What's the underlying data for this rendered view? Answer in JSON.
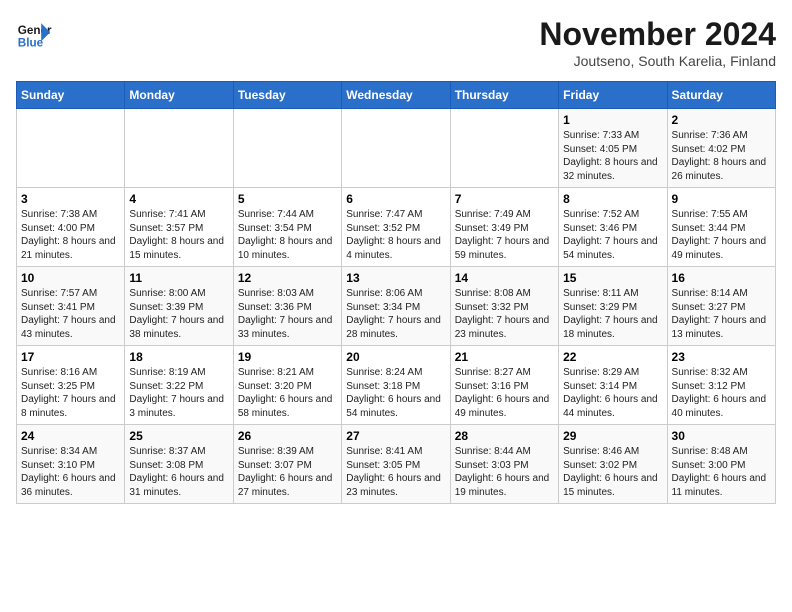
{
  "logo": {
    "line1": "General",
    "line2": "Blue"
  },
  "title": "November 2024",
  "subtitle": "Joutseno, South Karelia, Finland",
  "days_of_week": [
    "Sunday",
    "Monday",
    "Tuesday",
    "Wednesday",
    "Thursday",
    "Friday",
    "Saturday"
  ],
  "weeks": [
    [
      {
        "day": "",
        "detail": ""
      },
      {
        "day": "",
        "detail": ""
      },
      {
        "day": "",
        "detail": ""
      },
      {
        "day": "",
        "detail": ""
      },
      {
        "day": "",
        "detail": ""
      },
      {
        "day": "1",
        "detail": "Sunrise: 7:33 AM\nSunset: 4:05 PM\nDaylight: 8 hours and 32 minutes."
      },
      {
        "day": "2",
        "detail": "Sunrise: 7:36 AM\nSunset: 4:02 PM\nDaylight: 8 hours and 26 minutes."
      }
    ],
    [
      {
        "day": "3",
        "detail": "Sunrise: 7:38 AM\nSunset: 4:00 PM\nDaylight: 8 hours and 21 minutes."
      },
      {
        "day": "4",
        "detail": "Sunrise: 7:41 AM\nSunset: 3:57 PM\nDaylight: 8 hours and 15 minutes."
      },
      {
        "day": "5",
        "detail": "Sunrise: 7:44 AM\nSunset: 3:54 PM\nDaylight: 8 hours and 10 minutes."
      },
      {
        "day": "6",
        "detail": "Sunrise: 7:47 AM\nSunset: 3:52 PM\nDaylight: 8 hours and 4 minutes."
      },
      {
        "day": "7",
        "detail": "Sunrise: 7:49 AM\nSunset: 3:49 PM\nDaylight: 7 hours and 59 minutes."
      },
      {
        "day": "8",
        "detail": "Sunrise: 7:52 AM\nSunset: 3:46 PM\nDaylight: 7 hours and 54 minutes."
      },
      {
        "day": "9",
        "detail": "Sunrise: 7:55 AM\nSunset: 3:44 PM\nDaylight: 7 hours and 49 minutes."
      }
    ],
    [
      {
        "day": "10",
        "detail": "Sunrise: 7:57 AM\nSunset: 3:41 PM\nDaylight: 7 hours and 43 minutes."
      },
      {
        "day": "11",
        "detail": "Sunrise: 8:00 AM\nSunset: 3:39 PM\nDaylight: 7 hours and 38 minutes."
      },
      {
        "day": "12",
        "detail": "Sunrise: 8:03 AM\nSunset: 3:36 PM\nDaylight: 7 hours and 33 minutes."
      },
      {
        "day": "13",
        "detail": "Sunrise: 8:06 AM\nSunset: 3:34 PM\nDaylight: 7 hours and 28 minutes."
      },
      {
        "day": "14",
        "detail": "Sunrise: 8:08 AM\nSunset: 3:32 PM\nDaylight: 7 hours and 23 minutes."
      },
      {
        "day": "15",
        "detail": "Sunrise: 8:11 AM\nSunset: 3:29 PM\nDaylight: 7 hours and 18 minutes."
      },
      {
        "day": "16",
        "detail": "Sunrise: 8:14 AM\nSunset: 3:27 PM\nDaylight: 7 hours and 13 minutes."
      }
    ],
    [
      {
        "day": "17",
        "detail": "Sunrise: 8:16 AM\nSunset: 3:25 PM\nDaylight: 7 hours and 8 minutes."
      },
      {
        "day": "18",
        "detail": "Sunrise: 8:19 AM\nSunset: 3:22 PM\nDaylight: 7 hours and 3 minutes."
      },
      {
        "day": "19",
        "detail": "Sunrise: 8:21 AM\nSunset: 3:20 PM\nDaylight: 6 hours and 58 minutes."
      },
      {
        "day": "20",
        "detail": "Sunrise: 8:24 AM\nSunset: 3:18 PM\nDaylight: 6 hours and 54 minutes."
      },
      {
        "day": "21",
        "detail": "Sunrise: 8:27 AM\nSunset: 3:16 PM\nDaylight: 6 hours and 49 minutes."
      },
      {
        "day": "22",
        "detail": "Sunrise: 8:29 AM\nSunset: 3:14 PM\nDaylight: 6 hours and 44 minutes."
      },
      {
        "day": "23",
        "detail": "Sunrise: 8:32 AM\nSunset: 3:12 PM\nDaylight: 6 hours and 40 minutes."
      }
    ],
    [
      {
        "day": "24",
        "detail": "Sunrise: 8:34 AM\nSunset: 3:10 PM\nDaylight: 6 hours and 36 minutes."
      },
      {
        "day": "25",
        "detail": "Sunrise: 8:37 AM\nSunset: 3:08 PM\nDaylight: 6 hours and 31 minutes."
      },
      {
        "day": "26",
        "detail": "Sunrise: 8:39 AM\nSunset: 3:07 PM\nDaylight: 6 hours and 27 minutes."
      },
      {
        "day": "27",
        "detail": "Sunrise: 8:41 AM\nSunset: 3:05 PM\nDaylight: 6 hours and 23 minutes."
      },
      {
        "day": "28",
        "detail": "Sunrise: 8:44 AM\nSunset: 3:03 PM\nDaylight: 6 hours and 19 minutes."
      },
      {
        "day": "29",
        "detail": "Sunrise: 8:46 AM\nSunset: 3:02 PM\nDaylight: 6 hours and 15 minutes."
      },
      {
        "day": "30",
        "detail": "Sunrise: 8:48 AM\nSunset: 3:00 PM\nDaylight: 6 hours and 11 minutes."
      }
    ]
  ]
}
